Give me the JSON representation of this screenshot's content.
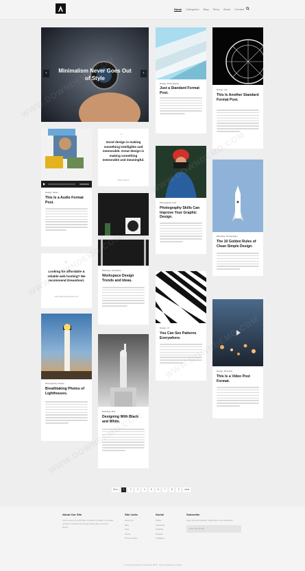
{
  "nav": {
    "items": [
      "Home",
      "Categories",
      "Blog",
      "Shop",
      "About",
      "Contact"
    ]
  },
  "slider": {
    "title": "Minimalism Never Goes Out of Style"
  },
  "posts": [
    {
      "meta": "Design, Photography",
      "title": "Just a Standard Format Post."
    },
    {
      "meta": "Design, Life",
      "title": "This Is Another Standard Format Post."
    },
    {
      "meta": "Design, Music",
      "title": "This Is a Audio Format Post."
    },
    {
      "meta": "Photography, Kids",
      "title": "Photography Skills Can Improve Your Graphic Design."
    },
    {
      "meta": "Branding, Photography",
      "title": "The 10 Golden Rules of Clean Simple Design."
    },
    {
      "meta": "Branding, Workplace",
      "title": "Workspace Design Trends and Ideas."
    },
    {
      "meta": "Design, UI",
      "title": "You Can See Patterns Everywhere."
    },
    {
      "meta": "Photography, Design",
      "title": "Breathtaking Photos of Lighthouses."
    },
    {
      "meta": "Design, Branding",
      "title": "This Is a Video Post Format."
    },
    {
      "meta": "Branding, Mist",
      "title": "Designing With Black and White."
    }
  ],
  "quote": {
    "text": "Good design is making something intelligible and memorable. Great design is making something memorable and meaningful.",
    "source": "Dieter Rams"
  },
  "ad": {
    "text": "Looking for affordable & reliable web hosting? We recommend Dreamhost.",
    "link": "http://www.dreamhost.com"
  },
  "pagination": [
    "Prev",
    "1",
    "2",
    "3",
    "4",
    "5",
    "6",
    "7",
    "8",
    "9",
    "Next"
  ],
  "footer": {
    "about": {
      "heading": "About Our Site",
      "text": "Lorem ipsum Ut velit dolor Ut labore id fugiat in ut fugiat nostrud ut deleniti sunt ipsum Dolor dolor eiusmod dolore."
    },
    "site_links": {
      "heading": "Site Links",
      "items": [
        "About Us",
        "Blog",
        "FAQ",
        "Terms",
        "Privacy Policy"
      ]
    },
    "social": {
      "heading": "Social",
      "items": [
        "Twitter",
        "Facebook",
        "Dribbble",
        "Google+",
        "Instagram"
      ]
    },
    "subscribe": {
      "heading": "Subscribe",
      "text": "Keep yourself updated. Subscribe to our newsletter.",
      "placeholder": "Type Your Email"
    },
    "copyright": "© Copyright Abstract Inspiration 2015 · Site Template by Colorlib"
  }
}
